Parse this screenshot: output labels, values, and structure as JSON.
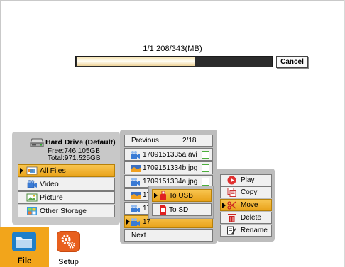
{
  "progress": {
    "text": "1/1   208/343(MB)",
    "fraction": 0.606,
    "cancel_label": "Cancel"
  },
  "storage": {
    "drive_name": "Hard Drive (Default)",
    "free": "Free:746.105GB",
    "total": "Total:971.525GB",
    "items": [
      {
        "label": "All Files",
        "icon": "all-files-icon",
        "selected": true
      },
      {
        "label": "Video",
        "icon": "video-icon",
        "selected": false
      },
      {
        "label": "Picture",
        "icon": "picture-icon",
        "selected": false
      },
      {
        "label": "Other Storage",
        "icon": "other-storage-icon",
        "selected": false
      }
    ]
  },
  "file_list": {
    "previous_label": "Previous",
    "page": "2/18",
    "next_label": "Next",
    "rows": [
      {
        "name": "1709151335a.avi",
        "type": "video",
        "checkbox": true
      },
      {
        "name": "1709151334b.jpg",
        "type": "picture",
        "checkbox": true
      },
      {
        "name": "1709151334a.jpg",
        "type": "video",
        "checkbox": true
      },
      {
        "name": "17",
        "type": "picture",
        "checkbox": false
      },
      {
        "name": "17",
        "type": "video",
        "checkbox": false
      },
      {
        "name": "17",
        "type": "video",
        "checkbox": false,
        "selected": true
      }
    ]
  },
  "target_popup": {
    "items": [
      {
        "label": "To USB",
        "icon": "usb-icon",
        "selected": true
      },
      {
        "label": "To SD",
        "icon": "sd-card-icon",
        "selected": false
      }
    ]
  },
  "actions": {
    "items": [
      {
        "label": "Play",
        "icon": "play-icon",
        "selected": false
      },
      {
        "label": "Copy",
        "icon": "copy-icon",
        "selected": false
      },
      {
        "label": "Move",
        "icon": "scissors-icon",
        "selected": true
      },
      {
        "label": "Delete",
        "icon": "trash-icon",
        "selected": false
      },
      {
        "label": "Rename",
        "icon": "rename-icon",
        "selected": false
      }
    ]
  },
  "tabs": {
    "file_label": "File",
    "setup_label": "Setup"
  },
  "colors": {
    "accent": "#F2A51B",
    "setup_icon": "#E8601E",
    "checkbox": "#4CAE3C"
  }
}
